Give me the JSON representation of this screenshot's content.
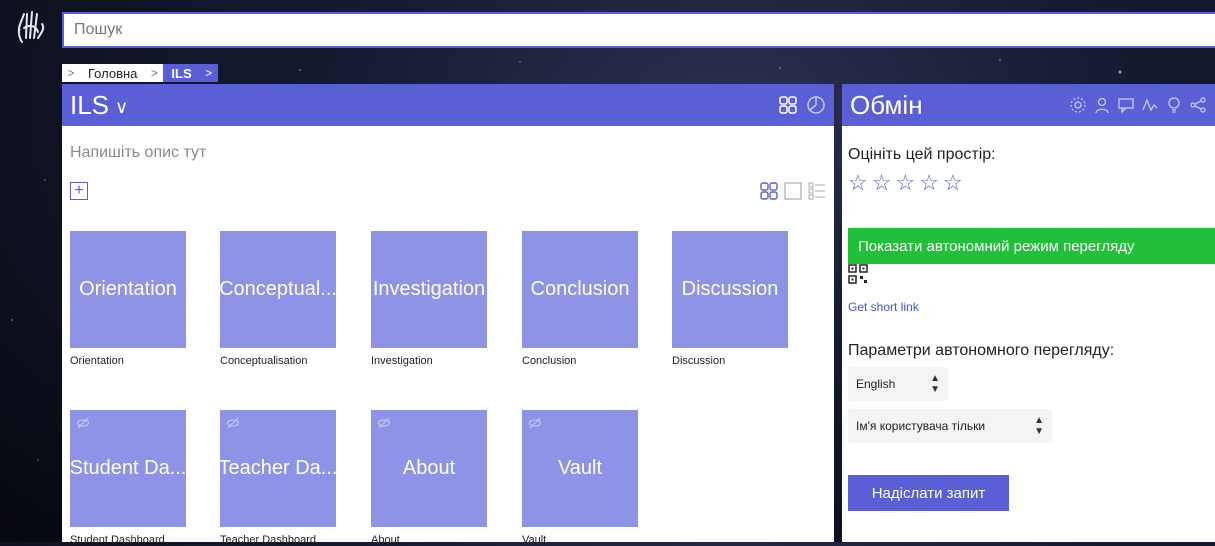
{
  "search": {
    "placeholder": "Пошук"
  },
  "breadcrumb": {
    "items": [
      "Головна",
      "ILS"
    ]
  },
  "left_panel": {
    "title": "ILS",
    "description": "Напишіть опис тут"
  },
  "tiles": [
    {
      "name": "Orientation",
      "caption": "Orientation",
      "hidden": false
    },
    {
      "name": "Conceptual...",
      "caption": "Conceptualisation",
      "hidden": false
    },
    {
      "name": "Investigation",
      "caption": "Investigation",
      "hidden": false
    },
    {
      "name": "Conclusion",
      "caption": "Conclusion",
      "hidden": false
    },
    {
      "name": "Discussion",
      "caption": "Discussion",
      "hidden": false
    },
    {
      "name": "Student Da...",
      "caption": "Student Dashboard",
      "hidden": true
    },
    {
      "name": "Teacher Da...",
      "caption": "Teacher Dashboard",
      "hidden": true
    },
    {
      "name": "About",
      "caption": "About",
      "hidden": true
    },
    {
      "name": "Vault",
      "caption": "Vault",
      "hidden": true
    }
  ],
  "right_panel": {
    "title": "Обмін",
    "rate_label": "Оцініть цей простір:",
    "stars": [
      "☆",
      "☆",
      "☆",
      "☆",
      "☆"
    ],
    "offline_button": "Показати автономний режим перегляду",
    "short_link": "Get short link",
    "params_label": "Параметри автономного перегляду:",
    "language_select": "English",
    "username_select": "Ім'я користувача тільки",
    "submit_button": "Надіслати запит"
  },
  "colors": {
    "accent": "#5b5fd6",
    "tile": "#8f93e6",
    "green": "#22c03a"
  }
}
